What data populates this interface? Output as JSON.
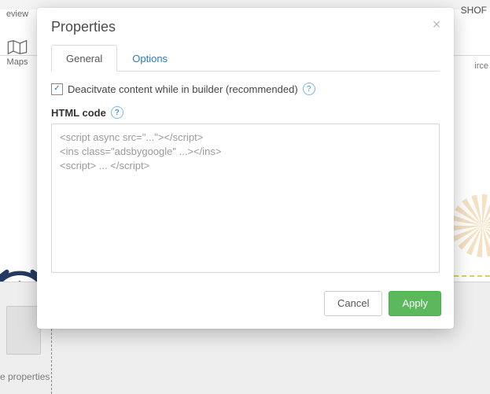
{
  "background": {
    "shop_text": "SHOF",
    "preview_label": "eview",
    "maps_label": "Maps",
    "source_label": "irce",
    "panel_label": "e properties"
  },
  "modal": {
    "title": "Properties",
    "tabs": {
      "general": "General",
      "options": "Options"
    },
    "deactivate": {
      "label": "Deacitvate content while in builder (recommended)",
      "checked": true
    },
    "html_section": {
      "label": "HTML code",
      "value": "<script async src=\"...\"></script>\n<ins class=\"adsbygoogle\" ...></ins>\n<script> ... </script>"
    },
    "buttons": {
      "cancel": "Cancel",
      "apply": "Apply"
    }
  }
}
